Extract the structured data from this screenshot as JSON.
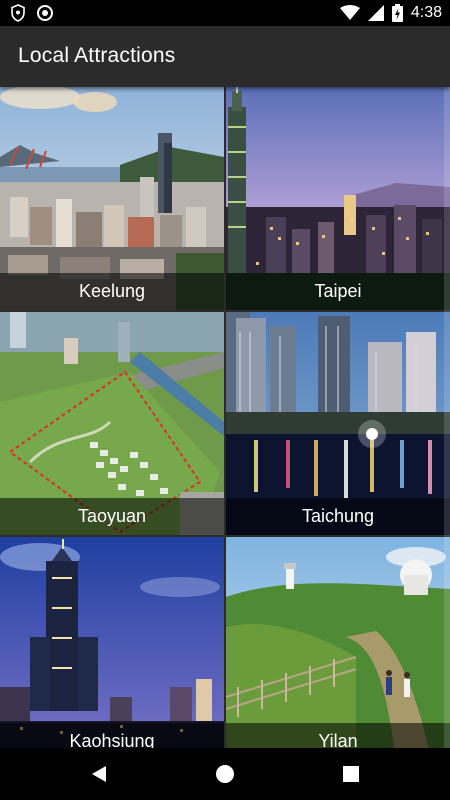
{
  "status_bar": {
    "time": "4:38",
    "icons": [
      "shield-icon",
      "sync-icon",
      "wifi-icon",
      "signal-icon",
      "battery-charging-icon"
    ]
  },
  "app_bar": {
    "title": "Local Attractions"
  },
  "attractions": [
    {
      "name": "Keelung"
    },
    {
      "name": "Taipei"
    },
    {
      "name": "Taoyuan"
    },
    {
      "name": "Taichung"
    },
    {
      "name": "Kaohsiung"
    },
    {
      "name": "Yilan"
    }
  ],
  "nav_bar": {
    "buttons": [
      "back-icon",
      "home-icon",
      "recents-icon"
    ]
  },
  "colors": {
    "app_bar": "#2b2b2b",
    "status_bar": "#000000",
    "caption_overlay": "rgba(0,0,0,0.55)"
  }
}
